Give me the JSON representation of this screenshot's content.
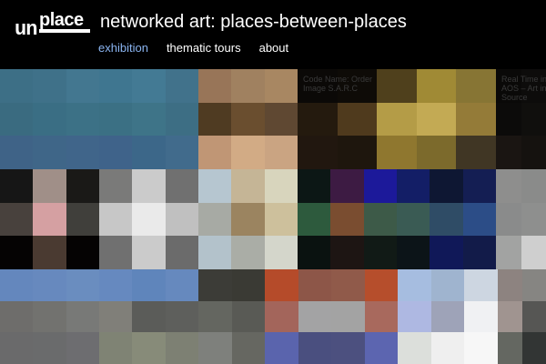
{
  "logo": {
    "un": "un",
    "place": "place"
  },
  "site_title": "networked art: places-between-places",
  "nav": {
    "items": [
      {
        "label": "exhibition",
        "active": true
      },
      {
        "label": "thematic tours",
        "active": false
      },
      {
        "label": "about",
        "active": false
      }
    ]
  },
  "colors": {
    "background": "#000000",
    "nav_active": "#8ab4f0",
    "nav_default": "#ffffff"
  },
  "tiles": [
    {
      "name": "artwork-tile-blue-teal",
      "caption": "",
      "rows": [
        [
          "#3d6f86",
          "#3f7189",
          "#437790",
          "#3f7690",
          "#437a94",
          "#41728b"
        ],
        [
          "#3a6b80",
          "#3a6e84",
          "#3c7186",
          "#3b7084",
          "#3e7488",
          "#3d6e84"
        ],
        [
          "#3f6387",
          "#3f6688",
          "#40658a",
          "#3f638a",
          "#3c6789",
          "#416b8c"
        ]
      ]
    },
    {
      "name": "artwork-tile-brown-tan",
      "caption": "",
      "rows": [
        [
          "#987558",
          "#a08160",
          "#a88762"
        ],
        [
          "#4f3b22",
          "#6a4e2f",
          "#5f4832"
        ],
        [
          "#c09675",
          "#d2ab85",
          "#caa482"
        ]
      ]
    },
    {
      "name": "artwork-tile-dark-gold",
      "caption": "Code Name: Order\nImage S.A.R.C",
      "rows": [
        [
          "#0b0907",
          "#0e0b07",
          "#4f401c",
          "#a08a35",
          "#877534"
        ],
        [
          "#241a0e",
          "#4f3a1d",
          "#b49c47",
          "#c3aa54",
          "#947b38"
        ],
        [
          "#21170f",
          "#1e160d",
          "#8f772f",
          "#7c6a2c",
          "#403624"
        ]
      ]
    },
    {
      "name": "artwork-tile-dark-text",
      "caption": "Real Time in\nAOS – Art in\nSource",
      "rows": [
        [
          "#0a0908",
          "#0d0c0b"
        ],
        [
          "#0c0b0a",
          "#100f0d"
        ],
        [
          "#1a1512",
          "#15120f"
        ]
      ]
    },
    {
      "name": "artwork-tile-grey-pink",
      "caption": "",
      "rows": [
        [
          "#161616",
          "#a08f88",
          "#1a1917",
          "#7a7a79",
          "#cbcbcb",
          "#707070"
        ],
        [
          "#48413d",
          "#d5a0a2",
          "#403f3b",
          "#c7c7c7",
          "#eaeaea",
          "#c0c0c0"
        ],
        [
          "#050303",
          "#4a3a31",
          "#050303",
          "#707070",
          "#cbcbcb",
          "#6b6b6b"
        ]
      ]
    },
    {
      "name": "artwork-tile-pale-beige",
      "caption": "",
      "rows": [
        [
          "#b6c6d0",
          "#c5b596",
          "#d8d5bd"
        ],
        [
          "#a7aaa4",
          "#9b8460",
          "#cdc09c"
        ],
        [
          "#b3c2cb",
          "#aaada6",
          "#d4d6cb"
        ]
      ]
    },
    {
      "name": "artwork-tile-navy-green",
      "caption": "",
      "rows": [
        [
          "#0c1715",
          "#3d1b43",
          "#1c199a",
          "#131e66",
          "#0e1733",
          "#141e53"
        ],
        [
          "#2d5a3d",
          "#7a4d30",
          "#3d5a48",
          "#3a5b54",
          "#2f4c66",
          "#2c4d87"
        ],
        [
          "#0a1210",
          "#1d1513",
          "#111a16",
          "#0c1418",
          "#101858",
          "#121b49"
        ]
      ]
    },
    {
      "name": "artwork-tile-light-grey",
      "caption": "",
      "rows": [
        [
          "#8e8e8d",
          "#8a8b8a"
        ],
        [
          "#8a8b8b",
          "#8e8f8e"
        ],
        [
          "#a2a3a2",
          "#cfcfcf"
        ]
      ]
    },
    {
      "name": "artwork-tile-cornflower",
      "caption": "",
      "rows": [
        [
          "#6487bd",
          "#6789be",
          "#6a8dbf",
          "#6689bf",
          "#5f85bb",
          "#6689be"
        ],
        [
          "#6e6d6b",
          "#72726f",
          "#787977",
          "#807f79",
          "#5b5c59",
          "#5e5f5c"
        ],
        [
          "#6a6a6b",
          "#6a6b6c",
          "#6d6d70",
          "#7f8374",
          "#878b79",
          "#7d8073"
        ]
      ]
    },
    {
      "name": "artwork-tile-dark-grey",
      "caption": "",
      "rows": [
        [
          "#3c3c37",
          "#3a3a34"
        ],
        [
          "#646660",
          "#595a55"
        ],
        [
          "#7e807c",
          "#666761"
        ]
      ]
    },
    {
      "name": "artwork-tile-rust-violet",
      "caption": "",
      "rows": [
        [
          "#b54b2a",
          "#8d5648",
          "#905a4a",
          "#b64e2c"
        ],
        [
          "#a3655b",
          "#a3a3a4",
          "#a3a3a3",
          "#a8695d"
        ],
        [
          "#5a64ad",
          "#4a4f7f",
          "#4c507f",
          "#5c65b0"
        ]
      ]
    },
    {
      "name": "artwork-tile-pale-blue-white",
      "caption": "",
      "rows": [
        [
          "#a6bde0",
          "#9fb4cf",
          "#cdd6e1"
        ],
        [
          "#aeb8e2",
          "#9ea3b8",
          "#f0f1f3"
        ],
        [
          "#dcdfdb",
          "#efefef",
          "#f7f7f7"
        ]
      ]
    },
    {
      "name": "artwork-tile-taupe",
      "caption": "",
      "rows": [
        [
          "#8d8380",
          "#868582"
        ],
        [
          "#a09490",
          "#565654"
        ],
        [
          "#646761",
          "#323534"
        ]
      ]
    }
  ]
}
